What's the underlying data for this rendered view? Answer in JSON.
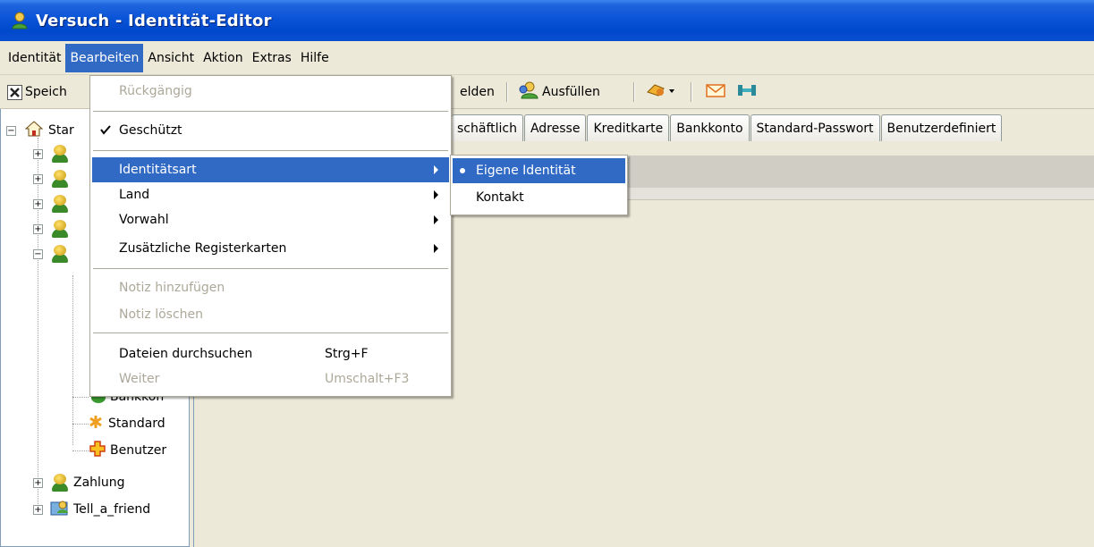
{
  "window": {
    "title": "Versuch - Identität-Editor"
  },
  "menubar": {
    "items": [
      {
        "label": "Identität"
      },
      {
        "label": "Bearbeiten"
      },
      {
        "label": "Ansicht"
      },
      {
        "label": "Aktion"
      },
      {
        "label": "Extras"
      },
      {
        "label": "Hilfe"
      }
    ]
  },
  "toolbar": {
    "save_label": "Speich",
    "report_label": "elden",
    "fill_label": "Ausfüllen"
  },
  "tree": {
    "root_label": "Star",
    "items": [
      {
        "label": "Bankkon"
      },
      {
        "label": "Standard"
      },
      {
        "label": "Benutzer"
      },
      {
        "label": "Zahlung"
      },
      {
        "label": "Tell_a_friend"
      }
    ]
  },
  "tabs": [
    {
      "label": "schäftlich"
    },
    {
      "label": "Adresse"
    },
    {
      "label": "Kreditkarte"
    },
    {
      "label": "Bankkonto"
    },
    {
      "label": "Standard-Passwort"
    },
    {
      "label": "Benutzerdefiniert"
    }
  ],
  "edit_menu": {
    "undo": "Rückgängig",
    "protected": "Geschützt",
    "identity_type": "Identitätsart",
    "country": "Land",
    "area_code": "Vorwahl",
    "extra_tabs": "Zusätzliche Registerkarten",
    "add_note": "Notiz hinzufügen",
    "delete_note": "Notiz löschen",
    "search_files": "Dateien durchsuchen",
    "search_files_shortcut": "Strg+F",
    "next": "Weiter",
    "next_shortcut": "Umschalt+F3"
  },
  "identity_submenu": {
    "own": "Eigene Identität",
    "contact": "Kontakt"
  },
  "colors": {
    "title_bar": "#0a54d8",
    "menu_highlight": "#316ac5",
    "disabled_text": "#aca899"
  }
}
